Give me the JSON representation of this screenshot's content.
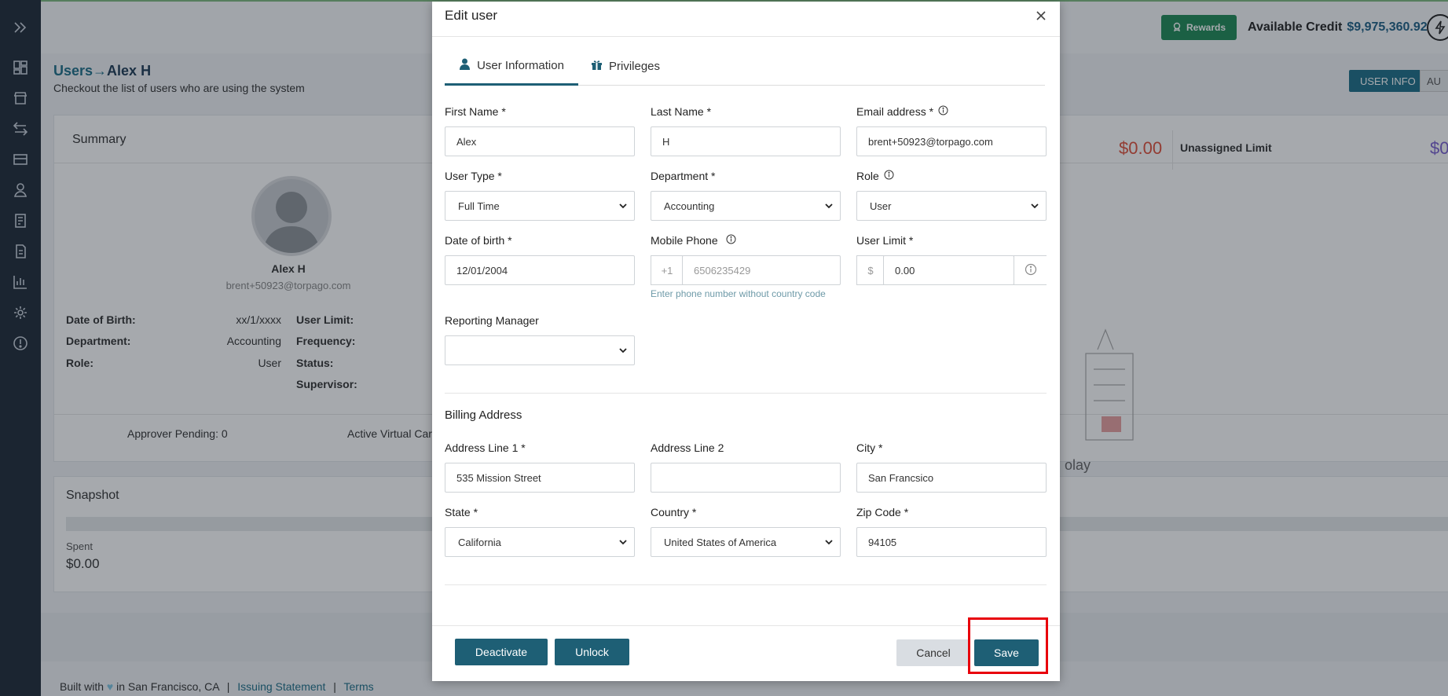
{
  "topbar": {
    "rewards_label": "Rewards",
    "credit_label": "Available Credit",
    "credit_amount": "$9,975,360.92"
  },
  "header": {
    "crumb_parent": "Users",
    "crumb_arrow": "→",
    "crumb_current": "Alex H",
    "subtitle": "Checkout the list of users who are using the system",
    "userinfo_button": "USER INFO",
    "au_button": "AU"
  },
  "summary": {
    "title": "Summary",
    "name": "Alex H",
    "email": "brent+50923@torpago.com",
    "dob_label": "Date of Birth:",
    "dob_value": "xx/1/xxxx",
    "dept_label": "Department:",
    "dept_value": "Accounting",
    "role_label": "Role:",
    "role_value": "User",
    "limit_label": "User Limit:",
    "frequency_label": "Frequency:",
    "status_label": "Status:",
    "supervisor_label": "Supervisor:",
    "approver_pending": "Approver Pending: 0",
    "active_virtual": "Active Virtual Car",
    "right_amount": "$0.00",
    "unassigned_limit_label": "Unassigned Limit",
    "unassigned_amount": "$0",
    "bg_text": "olay"
  },
  "snapshot": {
    "title": "Snapshot",
    "spent_label": "Spent",
    "spent_value": "$0.00"
  },
  "footer": {
    "built_prefix": "Built with",
    "built_suffix": "in San Francisco, CA",
    "sep": "|",
    "issuing_link": "Issuing Statement",
    "terms_link": "Terms"
  },
  "modal": {
    "title": "Edit user",
    "tabs": [
      {
        "label": "User Information"
      },
      {
        "label": "Privileges"
      }
    ],
    "fields": {
      "first_name": {
        "label": "First Name *",
        "value": "Alex"
      },
      "last_name": {
        "label": "Last Name *",
        "value": "H"
      },
      "email": {
        "label": "Email address *",
        "value": "brent+50923@torpago.com"
      },
      "user_type": {
        "label": "User Type *",
        "value": "Full Time"
      },
      "department": {
        "label": "Department *",
        "value": "Accounting"
      },
      "role": {
        "label": "Role",
        "value": "User"
      },
      "dob": {
        "label": "Date of birth *",
        "value": "12/01/2004"
      },
      "mobile": {
        "label": "Mobile Phone",
        "prefix": "+1",
        "value": "6506235429",
        "hint": "Enter phone number without country code"
      },
      "user_limit": {
        "label": "User Limit *",
        "prefix": "$",
        "value": "0.00"
      },
      "reporting_manager": {
        "label": "Reporting Manager",
        "value": ""
      },
      "address1": {
        "label": "Address Line 1 *",
        "value": "535 Mission Street"
      },
      "address2": {
        "label": "Address Line 2",
        "value": ""
      },
      "city": {
        "label": "City *",
        "value": "San Francsico"
      },
      "state": {
        "label": "State *",
        "value": "California"
      },
      "country": {
        "label": "Country *",
        "value": "United States of America"
      },
      "zip": {
        "label": "Zip Code *",
        "value": "94105"
      }
    },
    "billing_title": "Billing Address",
    "buttons": {
      "deactivate": "Deactivate",
      "unlock": "Unlock",
      "cancel": "Cancel",
      "save": "Save"
    }
  },
  "colors": {
    "primary": "#1e5f75",
    "rewards": "#1f8a56",
    "highlight": "#e8000b",
    "sidebar": "#1f2a37"
  }
}
